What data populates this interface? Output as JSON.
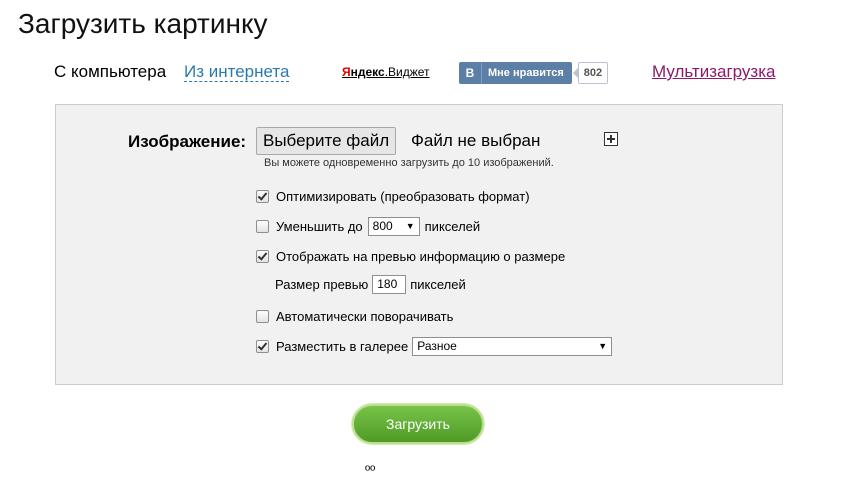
{
  "page": {
    "title": "Загрузить картинку"
  },
  "nav": {
    "from_computer": "С компьютера",
    "from_internet": "Из интернета",
    "yandex_widget": {
      "prefix_red": "Я",
      "prefix_black": "ндекс",
      "suffix": ".Виджет"
    },
    "vk_like": {
      "logo": "В",
      "label": "Мне нравится",
      "count": "802"
    },
    "multi_upload": "Мультизагрузка"
  },
  "form": {
    "image_label": "Изображение:",
    "file_button": "Выберите файл",
    "file_status": "Файл не выбран",
    "hint": "Вы можете одновременно загрузить до 10 изображений.",
    "options": {
      "optimize": {
        "label": "Оптимизировать (преобразовать формат)",
        "checked": true
      },
      "reduce": {
        "label_before": "Уменьшить до",
        "value": "800",
        "label_after": "пикселей",
        "checked": false
      },
      "preview_info": {
        "label": "Отображать на превью информацию о размере",
        "checked": true
      },
      "preview_size": {
        "label_before": "Размер превью",
        "value": "180",
        "label_after": "пикселей"
      },
      "auto_rotate": {
        "label": "Автоматически поворачивать",
        "checked": false
      },
      "gallery": {
        "label": "Разместить в галерее",
        "value": "Разное",
        "checked": true
      }
    },
    "submit": "Загрузить"
  },
  "footer_partial": "ºº",
  "colors": {
    "link": "#2a7ab0",
    "visited": "#8b1a6d",
    "button_green": "#5aab2f",
    "vk_blue": "#5b7fa6"
  }
}
